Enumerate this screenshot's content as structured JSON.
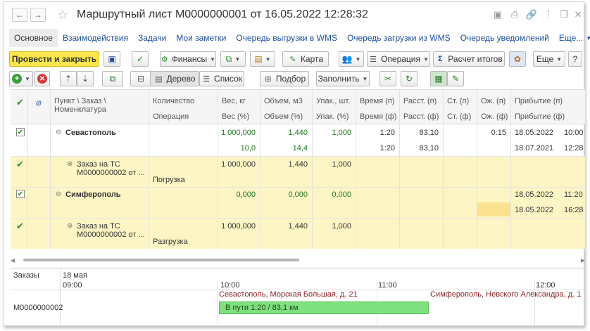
{
  "title": "Маршрутный лист М0000000001 от 16.05.2022 12:28:32",
  "tabs": [
    "Основное",
    "Взаимодействия",
    "Задачи",
    "Мои заметки",
    "Очередь выгрузки в WMS",
    "Очередь загрузки из WMS",
    "Очередь уведомлений",
    "Еще..."
  ],
  "toolbar": {
    "post_close": "Провести и закрыть",
    "finance": "Финансы",
    "map": "Карта",
    "operation": "Операция",
    "calc_totals": "Расчет итогов",
    "more": "Еще"
  },
  "toolbar2": {
    "tree": "Дерево",
    "list": "Список",
    "pick": "Подбор",
    "fill": "Заполнить"
  },
  "columns": {
    "point_order": "Пункт \\ Заказ \\",
    "nomenclature": "Номенклатура",
    "quantity": "Количество",
    "operation": "Операция",
    "weight": "Вес, кг",
    "weight_pct": "Вес (%)",
    "volume": "Объем, м3",
    "volume_pct": "Объем (%)",
    "packs": "Упак., шт.",
    "packs_pct": "Упак. (%)",
    "time_p": "Время (п)",
    "time_f": "Время (ф)",
    "dist_p": "Расст. (п)",
    "dist_f": "Расст. (ф)",
    "st_p": "Ст. (п)",
    "st_f": "Ст. (ф)",
    "wait_p": "Ож. (п)",
    "wait_f": "Ож. (ф)",
    "arrival_p": "Прибытие (п)",
    "arrival_f": "Прибытие (ф)"
  },
  "rows": [
    {
      "name": "Севастополь",
      "weight": "1 000,000",
      "volume": "1,440",
      "packs": "1,000",
      "time_p": "1:20",
      "dist_p": "83,10",
      "wait_p": "0:15",
      "arr_p": "18.05.2022",
      "arr_p_time": "10:00",
      "weight_pct": "10,0",
      "volume_pct": "14,4",
      "time_f": "1:20",
      "dist_f": "83,10",
      "arr_f": "18.07.2021",
      "arr_f_time": "12:28"
    },
    {
      "name": "Заказ на ТС",
      "name2": "М0000000002 от ...",
      "weight": "1 000,000",
      "volume": "1,440",
      "packs": "1,000",
      "operation": "Погрузка"
    },
    {
      "name": "Симферополь",
      "weight": "0,000",
      "volume": "0,000",
      "packs": "0,000",
      "arr_p": "18.05.2022",
      "arr_p_time": "11:20",
      "arr_f": "18.05.2022",
      "arr_f_time": "16:28"
    },
    {
      "name": "Заказ на ТС",
      "name2": "М0000000002 от ...",
      "weight": "1 000,000",
      "volume": "1,440",
      "packs": "1,000",
      "operation": "Разгрузка"
    }
  ],
  "gantt": {
    "orders_label": "Заказы",
    "date": "18 мая",
    "hours": [
      "09:00",
      "10:00",
      "11:00",
      "12:00"
    ],
    "order": "М0000000002",
    "seg1": "Севастополь, Морская Большая, д. 21",
    "seg2": "Симферополь, Невского Александра, д. 1",
    "bar": "В пути 1:20 / 83,1 км"
  },
  "colors": {
    "accent_yellow": "#fbe74c",
    "row_highlight": "#fdf5c4",
    "bar_green": "#7ee07e",
    "link_blue": "#1c4fa0"
  }
}
